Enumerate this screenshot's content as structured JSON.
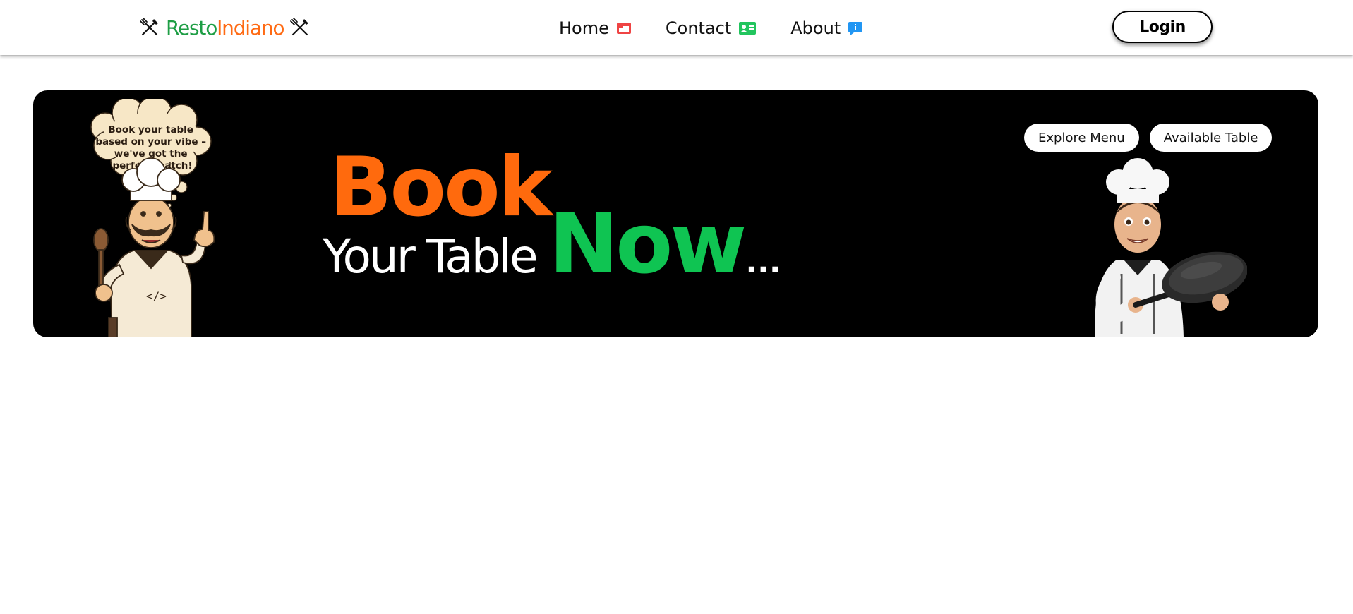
{
  "navbar": {
    "brand": {
      "part1": "Resto",
      "part2": "Indiano",
      "icon": "fork-knife-icon"
    },
    "links": [
      {
        "label": "Home",
        "icon": "browser-window-icon",
        "icon_color": "#ef4444"
      },
      {
        "label": "Contact",
        "icon": "contact-card-icon",
        "icon_color": "#22c55e"
      },
      {
        "label": "About",
        "icon": "info-bubble-icon",
        "icon_color": "#2196f3"
      }
    ],
    "login_label": "Login"
  },
  "hero": {
    "speech_bubble": [
      "Book your table",
      "based on your vibe –",
      "we've got the",
      "perfect match!"
    ],
    "headline": {
      "word1": "Book",
      "word2": "Your Table",
      "word3": "Now",
      "suffix": "..."
    },
    "buttons": {
      "explore": "Explore Menu",
      "available": "Available Table"
    },
    "colors": {
      "background": "#000000",
      "orange": "#ff6a0d",
      "green": "#0fc452"
    }
  }
}
